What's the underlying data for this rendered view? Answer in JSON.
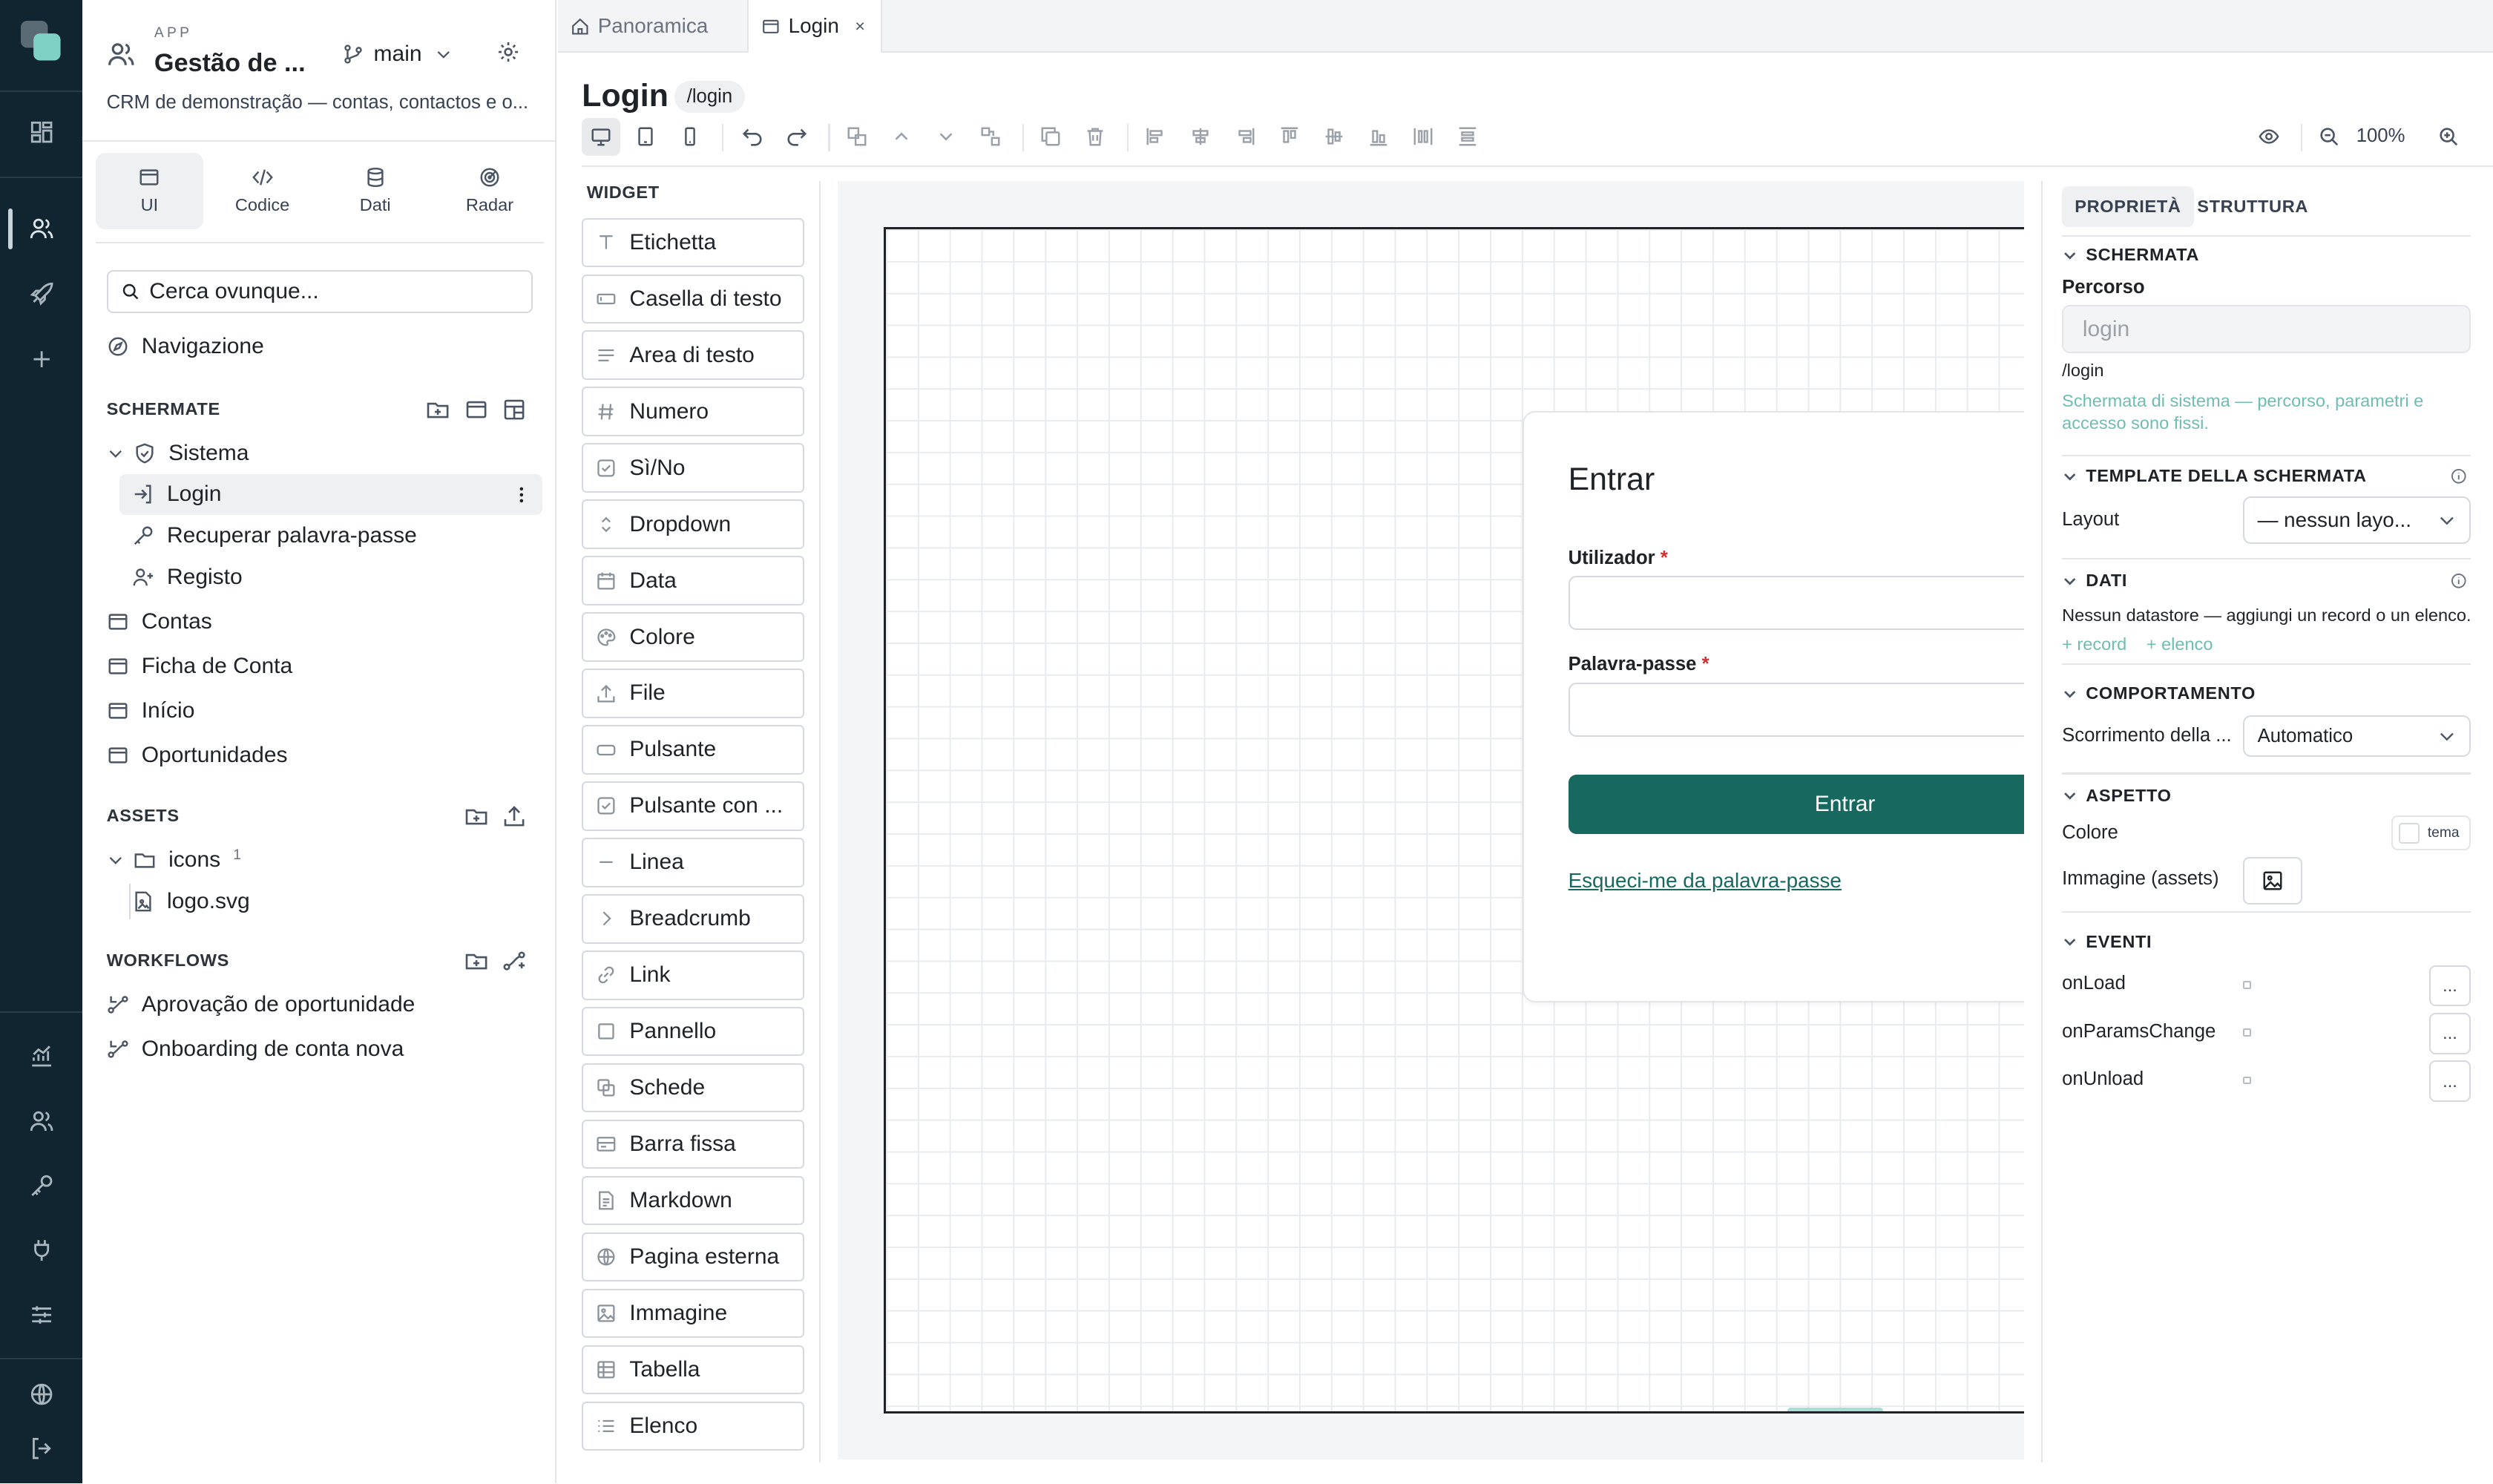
{
  "colors": {
    "rail": "#112531",
    "accent": "#17695f",
    "logo": "#7fd1c4"
  },
  "app": {
    "label": "APP",
    "name": "Gestão de ...",
    "branch": "main",
    "description": "CRM de demonstração — contas, contactos e o..."
  },
  "modes": [
    {
      "label": "UI",
      "icon": "window-icon"
    },
    {
      "label": "Codice",
      "icon": "code-icon"
    },
    {
      "label": "Dati",
      "icon": "database-icon"
    },
    {
      "label": "Radar",
      "icon": "radar-icon"
    }
  ],
  "search": {
    "placeholder": "Cerca ovunque..."
  },
  "navigation": {
    "label": "Navigazione"
  },
  "screens": {
    "title": "SCHERMATE",
    "group": "Sistema",
    "system_items": [
      "Login",
      "Recuperar palavra-passe",
      "Registo"
    ],
    "items": [
      "Contas",
      "Ficha de Conta",
      "Início",
      "Oportunidades"
    ]
  },
  "assets": {
    "title": "ASSETS",
    "folder": "icons",
    "folder_count": "1",
    "file": "logo.svg"
  },
  "workflows": {
    "title": "WORKFLOWS",
    "items": [
      "Aprovação de oportunidade",
      "Onboarding de conta nova"
    ]
  },
  "tabs": [
    {
      "label": "Panoramica",
      "icon": "home-icon"
    },
    {
      "label": "Login",
      "icon": "window-icon",
      "close": "×"
    }
  ],
  "page": {
    "title": "Login",
    "route": "/login",
    "zoom": "100%"
  },
  "widgets": {
    "title": "WIDGET",
    "items": [
      {
        "label": "Etichetta",
        "icon": "text-icon"
      },
      {
        "label": "Casella di testo",
        "icon": "textbox-icon"
      },
      {
        "label": "Area di testo",
        "icon": "textarea-icon"
      },
      {
        "label": "Numero",
        "icon": "hash-icon"
      },
      {
        "label": "Sì/No",
        "icon": "checkbox-icon"
      },
      {
        "label": "Dropdown",
        "icon": "chevrons-icon"
      },
      {
        "label": "Data",
        "icon": "calendar-icon"
      },
      {
        "label": "Colore",
        "icon": "palette-icon"
      },
      {
        "label": "File",
        "icon": "upload-icon"
      },
      {
        "label": "Pulsante",
        "icon": "button-icon"
      },
      {
        "label": "Pulsante con ...",
        "icon": "checkbox-icon"
      },
      {
        "label": "Linea",
        "icon": "minus-icon"
      },
      {
        "label": "Breadcrumb",
        "icon": "chevron-right-icon"
      },
      {
        "label": "Link",
        "icon": "link-icon"
      },
      {
        "label": "Pannello",
        "icon": "square-icon"
      },
      {
        "label": "Schede",
        "icon": "tabs-icon"
      },
      {
        "label": "Barra fissa",
        "icon": "card-icon"
      },
      {
        "label": "Markdown",
        "icon": "document-icon"
      },
      {
        "label": "Pagina esterna",
        "icon": "globe-icon"
      },
      {
        "label": "Immagine",
        "icon": "image-icon"
      },
      {
        "label": "Tabella",
        "icon": "table-icon"
      },
      {
        "label": "Elenco",
        "icon": "list-icon"
      }
    ]
  },
  "preview": {
    "title": "Entrar",
    "user_label": "Utilizador",
    "password_label": "Palavra-passe",
    "required": "*",
    "submit": "Entrar",
    "forgot_link": "Esqueci-me da palavra-passe"
  },
  "props": {
    "tabs": [
      "PROPRIETÀ",
      "STRUTTURA"
    ],
    "screen_section": "SCHERMATA",
    "route_label": "Percorso",
    "route_placeholder": "login",
    "route_value": "/login",
    "screen_note": "Schermata di sistema — percorso, parametri e accesso sono fissi.",
    "template_section": "TEMPLATE DELLA SCHERMATA",
    "layout_label": "Layout",
    "layout_value": "— nessun layo...",
    "data_section": "DATI",
    "data_note": "Nessun datastore — aggiungi un record o un elenco.",
    "add_record": "+ record",
    "add_list": "+ elenco",
    "behavior_section": "COMPORTAMENTO",
    "scroll_label": "Scorrimento della ...",
    "scroll_value": "Automatico",
    "look_section": "ASPETTO",
    "color_label": "Colore",
    "color_value": "tema",
    "image_label": "Immagine (assets)",
    "events_section": "EVENTI",
    "events": [
      "onLoad",
      "onParamsChange",
      "onUnload"
    ],
    "events_button": "..."
  }
}
